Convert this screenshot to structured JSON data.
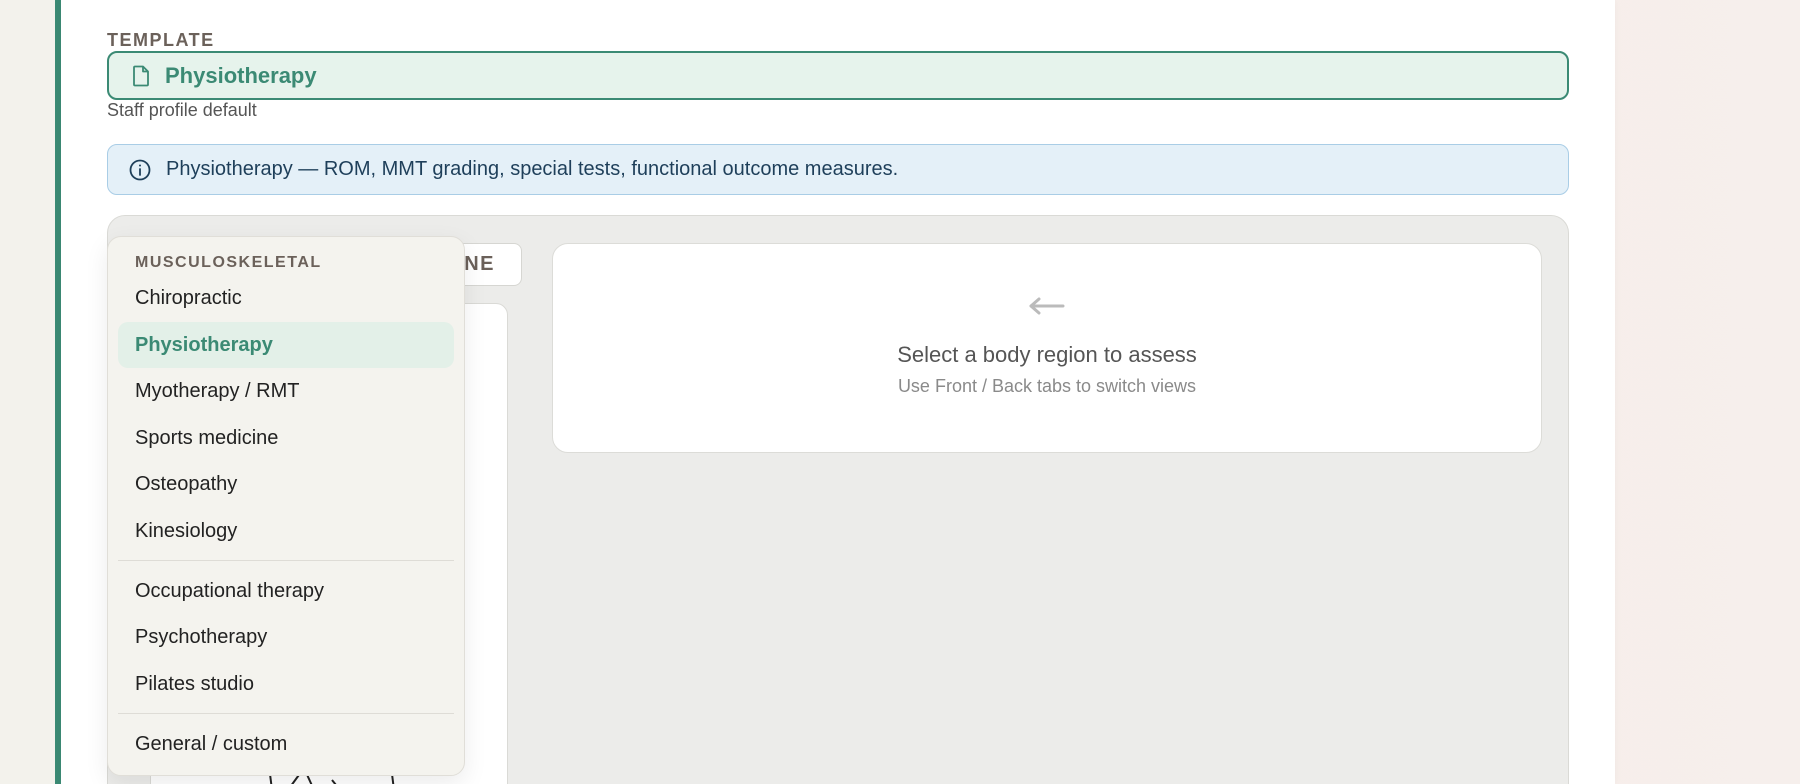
{
  "template": {
    "section_label": "TEMPLATE",
    "selected_value": "Physiotherapy",
    "helper_text": "Staff profile default"
  },
  "info_banner": {
    "text": "Physiotherapy — ROM, MMT grading, special tests, functional outcome measures."
  },
  "view_tab": {
    "label_visible": "NE"
  },
  "empty_state": {
    "title": "Select a body region to assess",
    "subtitle": "Use Front / Back tabs to switch views"
  },
  "dropdown": {
    "group_label": "MUSCULOSKELETAL",
    "options": [
      {
        "label": "Chiropractic"
      },
      {
        "label": "Physiotherapy"
      },
      {
        "label": "Myotherapy / RMT"
      },
      {
        "label": "Sports medicine"
      },
      {
        "label": "Osteopathy"
      },
      {
        "label": "Kinesiology"
      },
      {
        "label": "Occupational therapy"
      },
      {
        "label": "Psychotherapy"
      },
      {
        "label": "Pilates studio"
      },
      {
        "label": "General / custom"
      }
    ]
  },
  "colors": {
    "accent": "#3b8a74",
    "selected_bg": "#e3f0e8",
    "info_bg": "#e4f0f8",
    "info_text": "#1e3f5a"
  }
}
